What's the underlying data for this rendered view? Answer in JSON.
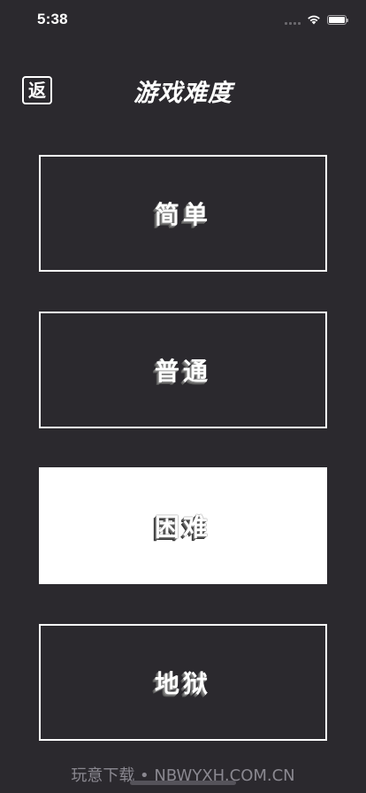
{
  "status_bar": {
    "time": "5:38"
  },
  "header": {
    "back_label": "返",
    "title": "游戏难度"
  },
  "levels": [
    {
      "label": "简单",
      "selected": false
    },
    {
      "label": "普通",
      "selected": false
    },
    {
      "label": "困难",
      "selected": true
    },
    {
      "label": "地狱",
      "selected": false
    }
  ],
  "watermark": "玩意下载 • NBWYXH.COM.CN",
  "colors": {
    "background": "#2b292e",
    "foreground": "#ffffff",
    "selected_fill": "#ffffff"
  }
}
